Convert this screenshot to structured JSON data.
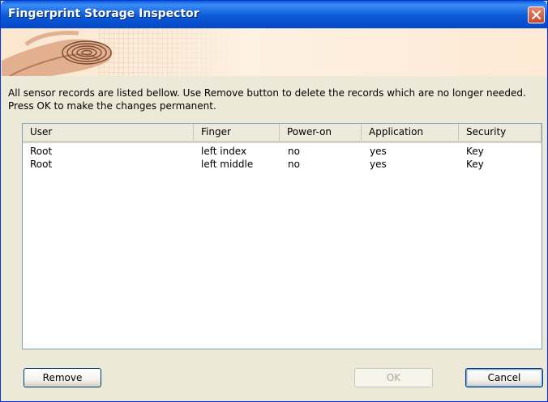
{
  "window": {
    "title": "Fingerprint Storage Inspector"
  },
  "instructions": "All sensor records are listed bellow. Use Remove button to delete the records which are no longer needed. Press OK to make the changes permanent.",
  "table": {
    "columns": [
      "User",
      "Finger",
      "Power-on",
      "Application",
      "Security"
    ],
    "rows": [
      [
        "Root",
        "left index",
        "no",
        "yes",
        "Key"
      ],
      [
        "Root",
        "left middle",
        "no",
        "yes",
        "Key"
      ]
    ]
  },
  "buttons": {
    "remove": "Remove",
    "ok": "OK",
    "cancel": "Cancel"
  },
  "icons": {
    "close": "close-icon",
    "banner": "fingerprint-hand-banner"
  }
}
